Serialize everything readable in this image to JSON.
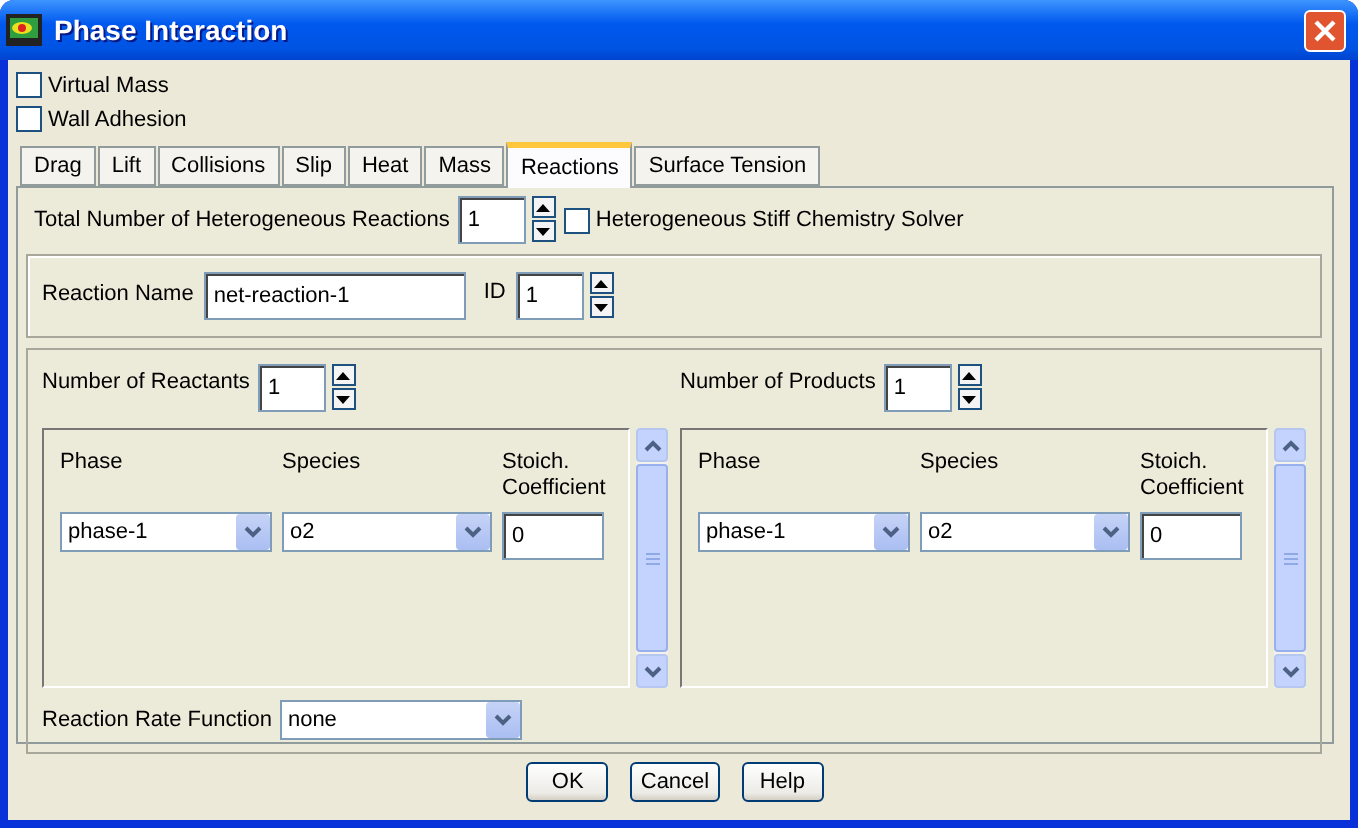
{
  "window": {
    "title": "Phase Interaction"
  },
  "options": [
    {
      "label": "Virtual Mass",
      "checked": false
    },
    {
      "label": "Wall Adhesion",
      "checked": false
    }
  ],
  "tabs": [
    {
      "label": "Drag",
      "selected": false
    },
    {
      "label": "Lift",
      "selected": false
    },
    {
      "label": "Collisions",
      "selected": false
    },
    {
      "label": "Slip",
      "selected": false
    },
    {
      "label": "Heat",
      "selected": false
    },
    {
      "label": "Mass",
      "selected": false
    },
    {
      "label": "Reactions",
      "selected": true
    },
    {
      "label": "Surface Tension",
      "selected": false
    }
  ],
  "reactions": {
    "total_label": "Total Number of Heterogeneous Reactions",
    "total": "1",
    "stiff_solver": {
      "label": "Heterogeneous Stiff Chemistry Solver",
      "checked": false
    },
    "name_label": "Reaction Name",
    "name": "net-reaction-1",
    "id_label": "ID",
    "id": "1",
    "sides": [
      {
        "count_label": "Number of Reactants",
        "count": "1",
        "columns": [
          "Phase",
          "Species",
          "Stoich. Coefficient"
        ],
        "rows": [
          {
            "phase": "phase-1",
            "species": "o2",
            "coefficient": "0"
          }
        ]
      },
      {
        "count_label": "Number of Products",
        "count": "1",
        "columns": [
          "Phase",
          "Species",
          "Stoich. Coefficient"
        ],
        "rows": [
          {
            "phase": "phase-1",
            "species": "o2",
            "coefficient": "0"
          }
        ]
      }
    ],
    "rate_label": "Reaction Rate Function",
    "rate": "none"
  },
  "buttons": [
    "OK",
    "Cancel",
    "Help"
  ]
}
